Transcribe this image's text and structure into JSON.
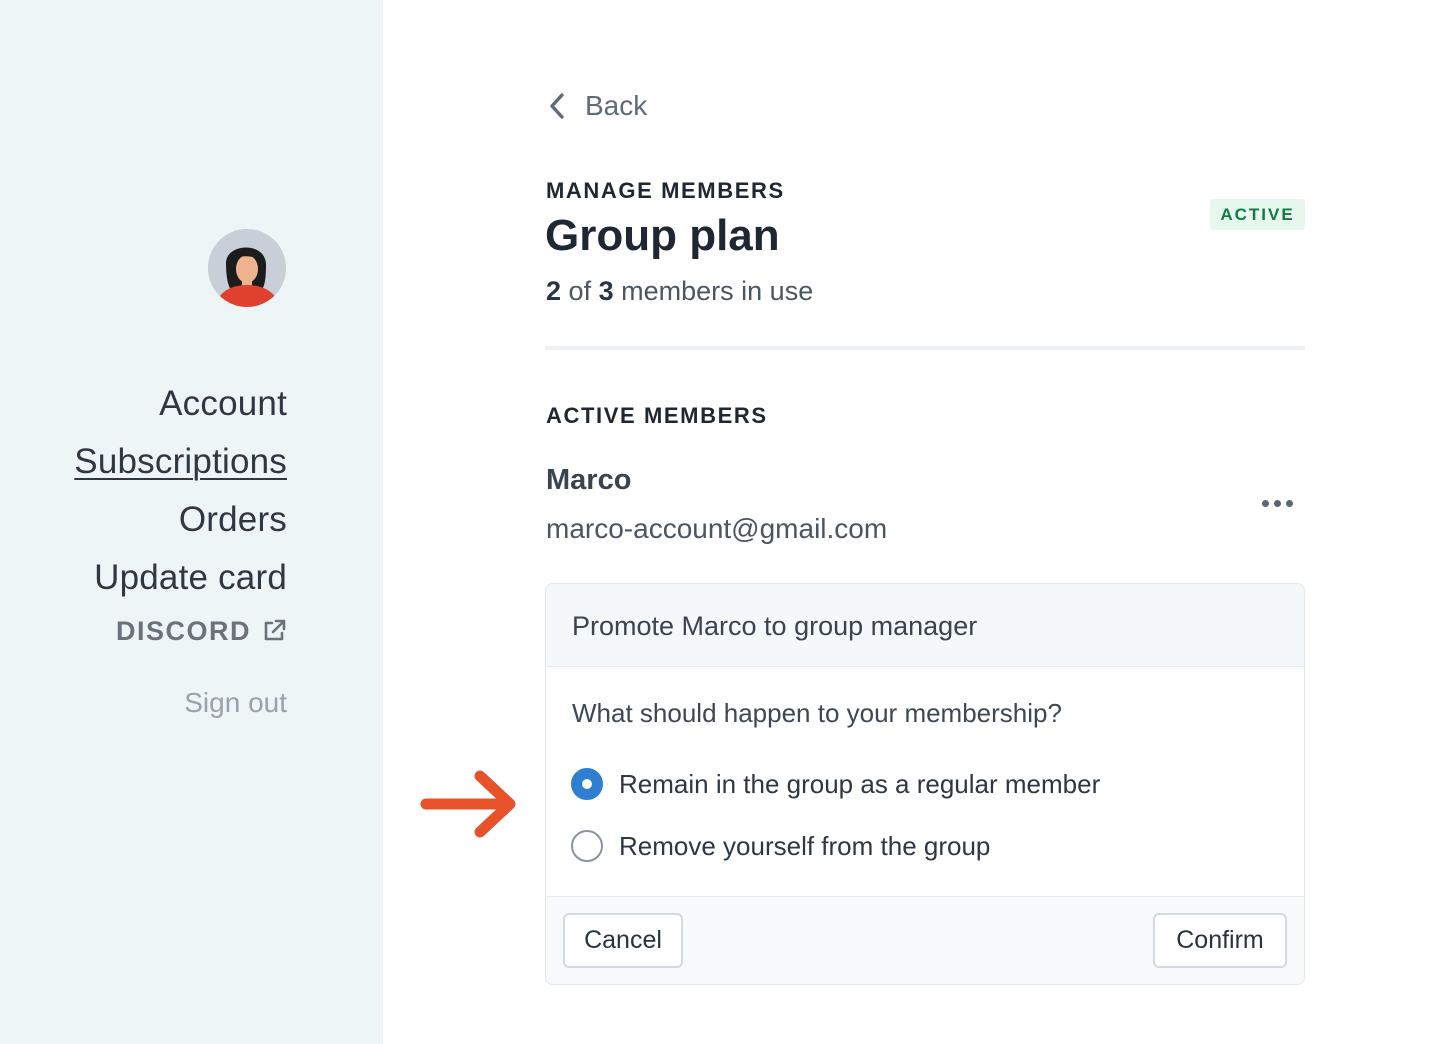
{
  "sidebar": {
    "avatar_alt": "User avatar",
    "nav": [
      {
        "label": "Account",
        "current": false
      },
      {
        "label": "Subscriptions",
        "current": true
      },
      {
        "label": "Orders",
        "current": false
      },
      {
        "label": "Update card",
        "current": false
      }
    ],
    "discord_label": "DISCORD",
    "discord_icon": "external-link-icon",
    "signout_label": "Sign out"
  },
  "main": {
    "back_label": "Back",
    "back_icon": "chevron-left-icon",
    "eyebrow": "MANAGE MEMBERS",
    "title": "Group plan",
    "usage": {
      "used": "2",
      "of": "of",
      "total": "3",
      "suffix": "members in use"
    },
    "status_badge": "ACTIVE",
    "section_title": "ACTIVE MEMBERS",
    "member": {
      "name": "Marco",
      "email": "marco-account@gmail.com",
      "more_icon": "more-horizontal-icon"
    },
    "promote_card": {
      "heading": "Promote Marco to group manager",
      "question": "What should happen to your membership?",
      "options": [
        {
          "label": "Remain in the group as a regular member",
          "selected": true
        },
        {
          "label": "Remove yourself from the group",
          "selected": false
        }
      ],
      "cancel_label": "Cancel",
      "confirm_label": "Confirm"
    }
  },
  "annotation": {
    "icon": "arrow-right-icon",
    "color": "#e8522a"
  },
  "colors": {
    "sidebar_bg": "#edf5f7",
    "accent_blue": "#2f7fd1",
    "badge_green": "#127a45",
    "badge_bg": "#e6f7ee"
  }
}
